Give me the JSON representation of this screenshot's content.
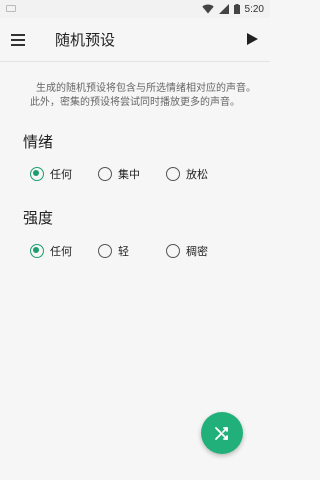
{
  "status_bar": {
    "time": "5:20",
    "icons": [
      "wifi-icon",
      "signal-icon",
      "battery-icon"
    ]
  },
  "app_bar": {
    "title": "随机预设",
    "menu_icon": "menu-icon",
    "play_icon": "play-icon"
  },
  "description": {
    "line1": "生成的随机预设将包含与所选情绪相对应的声音。",
    "line2": "此外，密集的预设将尝试同时播放更多的声音。"
  },
  "mood": {
    "title": "情绪",
    "options": [
      {
        "label": "任何",
        "selected": true
      },
      {
        "label": "集中",
        "selected": false
      },
      {
        "label": "放松",
        "selected": false
      }
    ]
  },
  "intensity": {
    "title": "强度",
    "options": [
      {
        "label": "任何",
        "selected": true
      },
      {
        "label": "轻",
        "selected": false
      },
      {
        "label": "稠密",
        "selected": false
      }
    ]
  },
  "fab": {
    "icon": "shuffle-icon",
    "color": "#22b07a"
  },
  "colors": {
    "accent": "#1e9e6e",
    "background": "#f6f6f6"
  }
}
